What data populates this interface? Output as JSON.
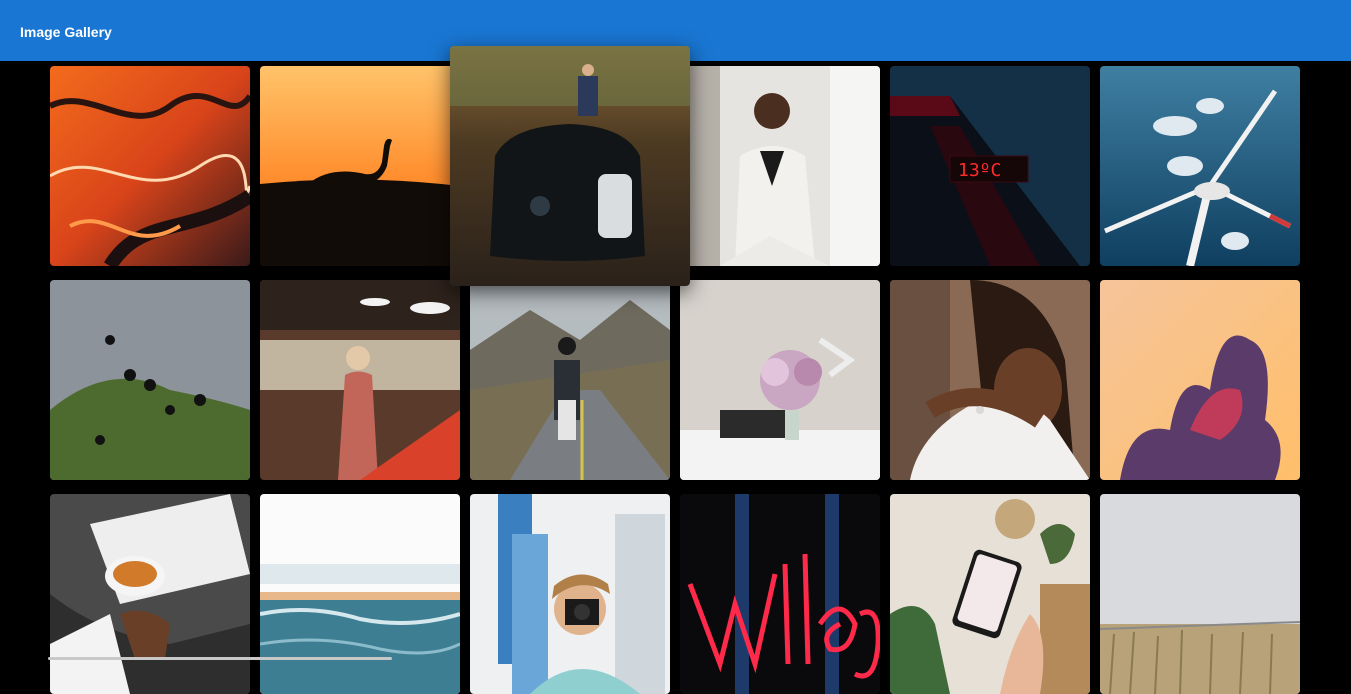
{
  "app": {
    "title": "Image Gallery"
  },
  "gallery": {
    "images": [
      {
        "subject": "orange-marble-abstract"
      },
      {
        "subject": "ostrich-sunset-silhouette"
      },
      {
        "subject": "backpack-on-rocks-in-forest"
      },
      {
        "subject": "woman-in-white-suit"
      },
      {
        "subject": "red-thermometer-sign",
        "sign_text": "13ºC"
      },
      {
        "subject": "wind-turbine-sky"
      },
      {
        "subject": "puffins-on-hill"
      },
      {
        "subject": "woman-in-restaurant"
      },
      {
        "subject": "motorcyclist-mountain-road"
      },
      {
        "subject": "flowers-on-desk"
      },
      {
        "subject": "couple-hug-ring"
      },
      {
        "subject": "smoke-cloud-sunset"
      },
      {
        "subject": "tea-and-book"
      },
      {
        "subject": "ocean-waves"
      },
      {
        "subject": "man-with-camera-city"
      },
      {
        "subject": "neon-sign"
      },
      {
        "subject": "phone-in-hand"
      },
      {
        "subject": "grass-field-sky"
      }
    ]
  }
}
